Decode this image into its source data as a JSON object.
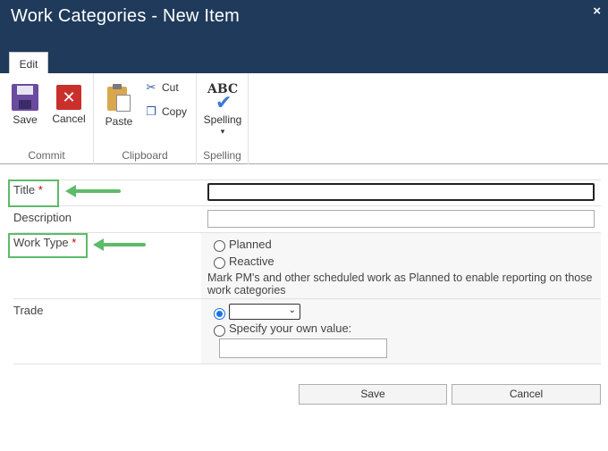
{
  "window": {
    "title": "Work Categories - New Item",
    "close_label": "×"
  },
  "ribbon": {
    "tab_label": "Edit",
    "commit": {
      "group_label": "Commit",
      "save_label": "Save",
      "cancel_label": "Cancel"
    },
    "clipboard": {
      "group_label": "Clipboard",
      "paste_label": "Paste",
      "cut_label": "Cut",
      "copy_label": "Copy"
    },
    "spelling": {
      "group_label": "Spelling",
      "button_label": "Spelling",
      "icon_text": "ABC",
      "check_glyph": "✔",
      "arrow": "▾"
    }
  },
  "form": {
    "required_marker": "*",
    "title": {
      "label": "Title",
      "value": ""
    },
    "description": {
      "label": "Description",
      "value": ""
    },
    "work_type": {
      "label": "Work Type",
      "options": [
        "Planned",
        "Reactive"
      ],
      "help": "Mark PM's and other scheduled work as Planned to enable reporting on those work categories"
    },
    "trade": {
      "label": "Trade",
      "selected_value": "",
      "dropdown_chevron": "⌄",
      "custom_label": "Specify your own value:",
      "custom_value": ""
    }
  },
  "actions": {
    "save_label": "Save",
    "cancel_label": "Cancel"
  },
  "colors": {
    "titlebar": "#1f3a5a",
    "highlight": "#5dbb6a",
    "required": "#cc0000"
  }
}
